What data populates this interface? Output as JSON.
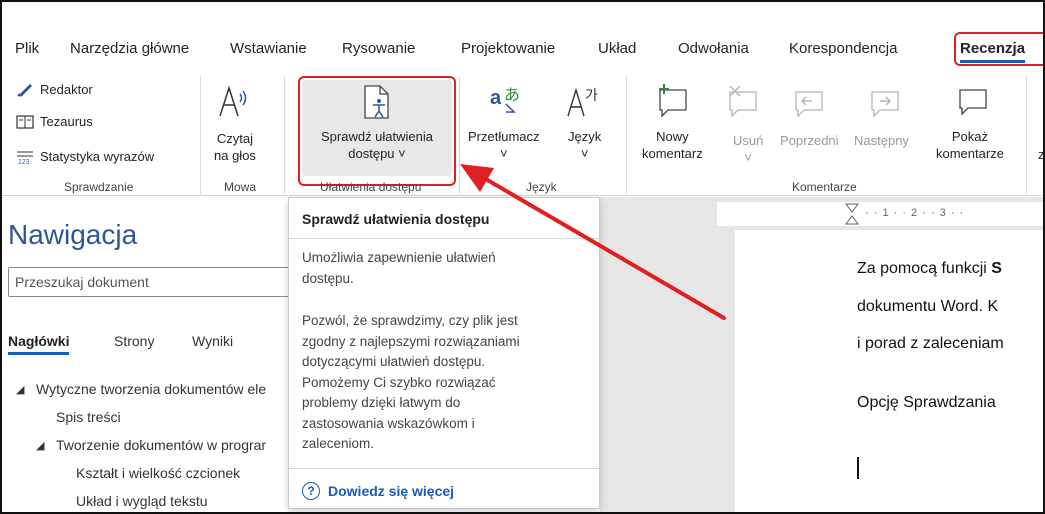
{
  "menu": {
    "items": [
      "Plik",
      "Narzędzia główne",
      "Wstawianie",
      "Rysowanie",
      "Projektowanie",
      "Układ",
      "Odwołania",
      "Korespondencja",
      "Recenzja"
    ],
    "active": "Recenzja"
  },
  "ribbon": {
    "sprawdzanie": {
      "redaktor": "Redaktor",
      "tezaurus": "Tezaurus",
      "statystyka": "Statystyka wyrazów",
      "group": "Sprawdzanie"
    },
    "mowa": {
      "czytaj_1": "Czytaj",
      "czytaj_2": "na głos",
      "group": "Mowa"
    },
    "ulatwienia": {
      "label_1": "Sprawdź ułatwienia",
      "label_2": "dostępu ˅",
      "group": "Ułatwienia dostępu"
    },
    "jezyk": {
      "przetlumacz": "Przetłumacz",
      "jezyk": "Język",
      "chev": "˅",
      "group": "Język"
    },
    "komentarze": {
      "nowy_1": "Nowy",
      "nowy_2": "komentarz",
      "usun": "Usuń",
      "usun_chev": "˅",
      "poprzedni": "Poprzedni",
      "nastepny": "Następny",
      "pokaz_1": "Pokaż",
      "pokaz_2": "komentarze",
      "group": "Komentarze",
      "cut_letter": "z"
    }
  },
  "nav": {
    "title": "Nawigacja",
    "search_placeholder": "Przeszukaj dokument",
    "tabs": [
      "Nagłówki",
      "Strony",
      "Wyniki"
    ],
    "tree": [
      "Wytyczne tworzenia dokumentów ele",
      "Spis treści",
      "Tworzenie dokumentów w prograr",
      "Kształt i wielkość czcionek",
      "Układ i wygląd tekstu"
    ]
  },
  "tooltip": {
    "title": "Sprawdź ułatwienia dostępu",
    "p1": [
      "Umożliwia zapewnienie ułatwień",
      "dostępu."
    ],
    "p2": [
      "Pozwól, że sprawdzimy, czy plik jest",
      "zgodny z najlepszymi rozwiązaniami",
      "dotyczącymi ułatwień dostępu.",
      "Pomożemy Ci szybko rozwiązać",
      "problemy dzięki łatwym do",
      "zastosowania wskazówkom i",
      "zaleceniom."
    ],
    "link": "Dowiedz się więcej",
    "link_icon": "?"
  },
  "ruler": "· · 1 · · 2 · · 3 · ·",
  "document": {
    "lines": [
      {
        "pre": "Za pomocą funkcji ",
        "bold": "S"
      },
      {
        "pre": "dokumentu Word. K",
        "bold": ""
      },
      {
        "pre": "i porad z zaleceniam",
        "bold": ""
      },
      {
        "pre": "Opcję Sprawdzania",
        "bold": ""
      }
    ]
  },
  "colors": {
    "accent": "#185abd",
    "highlight": "#e02020",
    "nav_title": "#2b579a"
  }
}
